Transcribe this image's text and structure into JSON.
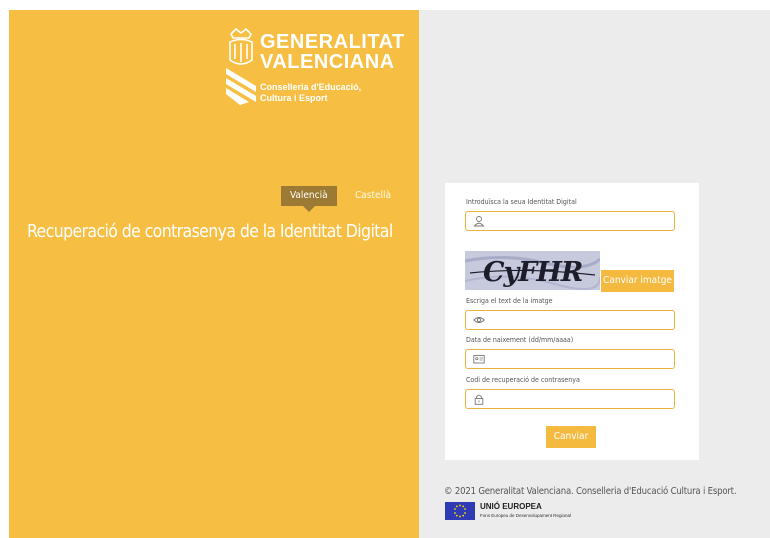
{
  "branding": {
    "name_line1": "GENERALITAT",
    "name_line2": "VALENCIANA",
    "dept_line1": "Conselleria d'Educació,",
    "dept_line2": "Cultura i Esport"
  },
  "languages": {
    "active": "Valencià",
    "other": "Castellà"
  },
  "page_title": "Recuperació de contrasenya de la Identitat Digital",
  "form": {
    "identity_label": "Introduïsca la seua Identitat Digital",
    "identity_value": "",
    "identity_icon": "user-icon",
    "captcha_text": "CyFHR",
    "change_image_label": "Canviar imatge",
    "captcha_label": "Escriga el text de la imatge",
    "captcha_value": "",
    "captcha_icon": "eye-icon",
    "birthdate_label": "Data de naixement (dd/mm/aaaa)",
    "birthdate_value": "",
    "birthdate_icon": "id-card-icon",
    "recovery_code_label": "Codi de recuperació de contrasenya",
    "recovery_code_value": "",
    "recovery_code_icon": "lock-icon",
    "submit_label": "Canviar"
  },
  "footer": {
    "copyright": "© 2021 Generalitat Valenciana. Conselleria d'Educació Cultura i Esport.",
    "eu_title": "UNIÓ EUROPEA",
    "eu_subtitle": "Fons Europeu de Desenvolupament Regional"
  },
  "colors": {
    "accent": "#f6bf44",
    "button": "#f3ba3f",
    "language_active": "#9c7a33",
    "panel": "#ececec"
  }
}
